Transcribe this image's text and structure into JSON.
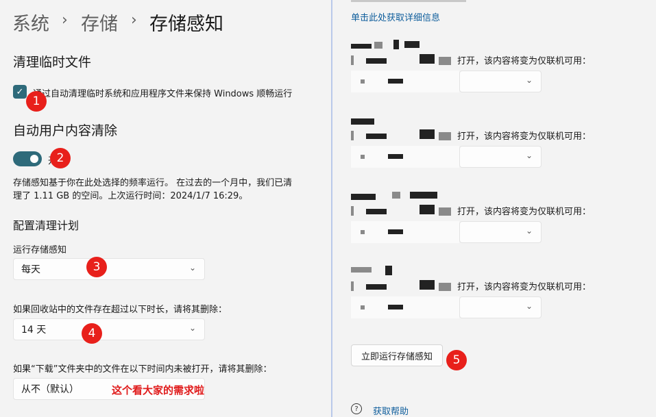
{
  "breadcrumb": {
    "system": "系统",
    "storage": "存储",
    "current": "存储感知",
    "separator": "›"
  },
  "temp_files": {
    "heading": "清理临时文件",
    "checkbox_label": "通过自动清理临时系统和应用程序文件来保持 Windows 顺畅运行",
    "checkbox_checked": true,
    "checkbox_glyph": "✓"
  },
  "auto_cleanup": {
    "heading": "自动用户内容清除",
    "toggle_state": "开",
    "toggle_on": true,
    "description_line1": "存储感知基于你在此处选择的频率运行。 在过去的一个月中，我们已清",
    "description_line2": "理了 1.11 GB 的空间。上次运行时间：2024/1/7 16:29。"
  },
  "schedule": {
    "heading": "配置清理计划",
    "run_label": "运行存储感知",
    "run_value": "每天",
    "recycle_label": "如果回收站中的文件存在超过以下时长，请将其删除：",
    "recycle_value": "14 天",
    "downloads_label": "如果“下载”文件夹中的文件在以下时间内未被打开，请将其删除：",
    "downloads_value": "从不（默认）",
    "caret": "⌄"
  },
  "annotations": {
    "badge1": "1",
    "badge2": "2",
    "badge3": "3",
    "badge4": "4",
    "badge5": "5",
    "note": "这个看大家的需求啦"
  },
  "right": {
    "details_link": "单击此处获取详细信息",
    "offline_text": "打开，该内容将变为仅联机可用：",
    "run_now_button": "立即运行存储感知",
    "help_link": "获取帮助",
    "help_icon": "?"
  },
  "colors": {
    "accent": "#2e6a7a",
    "badge": "#e8201b",
    "link": "#0f5e9c"
  }
}
